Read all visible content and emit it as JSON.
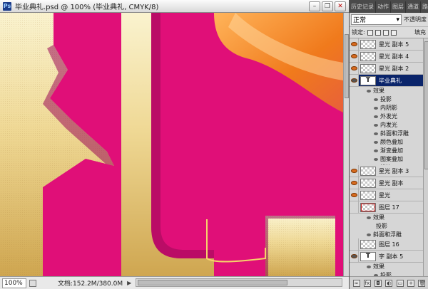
{
  "document": {
    "title": "毕业典礼.psd @ 100% (毕业典礼, CMYK/8)",
    "zoom": "100%",
    "doc_info": "文档:152.2M/380.0M",
    "app_icon": "Ps"
  },
  "window_buttons": [
    "minimize-icon",
    "restore-icon",
    "close-icon"
  ],
  "canvas_colors": {
    "magenta": "#e00f78",
    "gold_light": "#f7ecc2",
    "gold_dark": "#d2ab55",
    "orange": "#f07a1c"
  },
  "panel": {
    "tabs": [
      "历史记录",
      "动作",
      "图层",
      "通道",
      "路径"
    ],
    "blend_mode": "正常",
    "opacity_label": "不透明度",
    "lock_label": "锁定:",
    "fill_label": "填充"
  },
  "layers": [
    {
      "name": "星光 副本 5",
      "type": "image",
      "visible": true
    },
    {
      "name": "星光 副本 4",
      "type": "image",
      "visible": true
    },
    {
      "name": "星光 副本 2",
      "type": "image",
      "visible": true
    },
    {
      "name": "毕业典礼",
      "type": "text",
      "visible": true,
      "selected": true
    },
    {
      "name": "星光 副本 3",
      "type": "image",
      "visible": true
    },
    {
      "name": "星光 副本",
      "type": "image",
      "visible": true
    },
    {
      "name": "星光",
      "type": "image",
      "visible": true
    },
    {
      "name": "图层 17",
      "type": "image",
      "visible": false
    },
    {
      "name": "图层 16",
      "type": "image",
      "visible": false
    },
    {
      "name": "字 副本 5",
      "type": "text",
      "visible": true
    }
  ],
  "effects": {
    "header": "效果",
    "main_list": [
      "投影",
      "内阴影",
      "外发光",
      "内发光",
      "斜面和浮雕",
      "颜色叠加",
      "渐变叠加",
      "图案叠加",
      "描边"
    ],
    "layer17_list": [
      "投影",
      "斜面和浮雕"
    ],
    "layer_text5_list": [
      "投影"
    ]
  },
  "footer_icons": [
    "link-icon",
    "fx-icon",
    "mask-icon",
    "adjustment-icon",
    "folder-icon",
    "new-layer-icon",
    "trash-icon"
  ]
}
